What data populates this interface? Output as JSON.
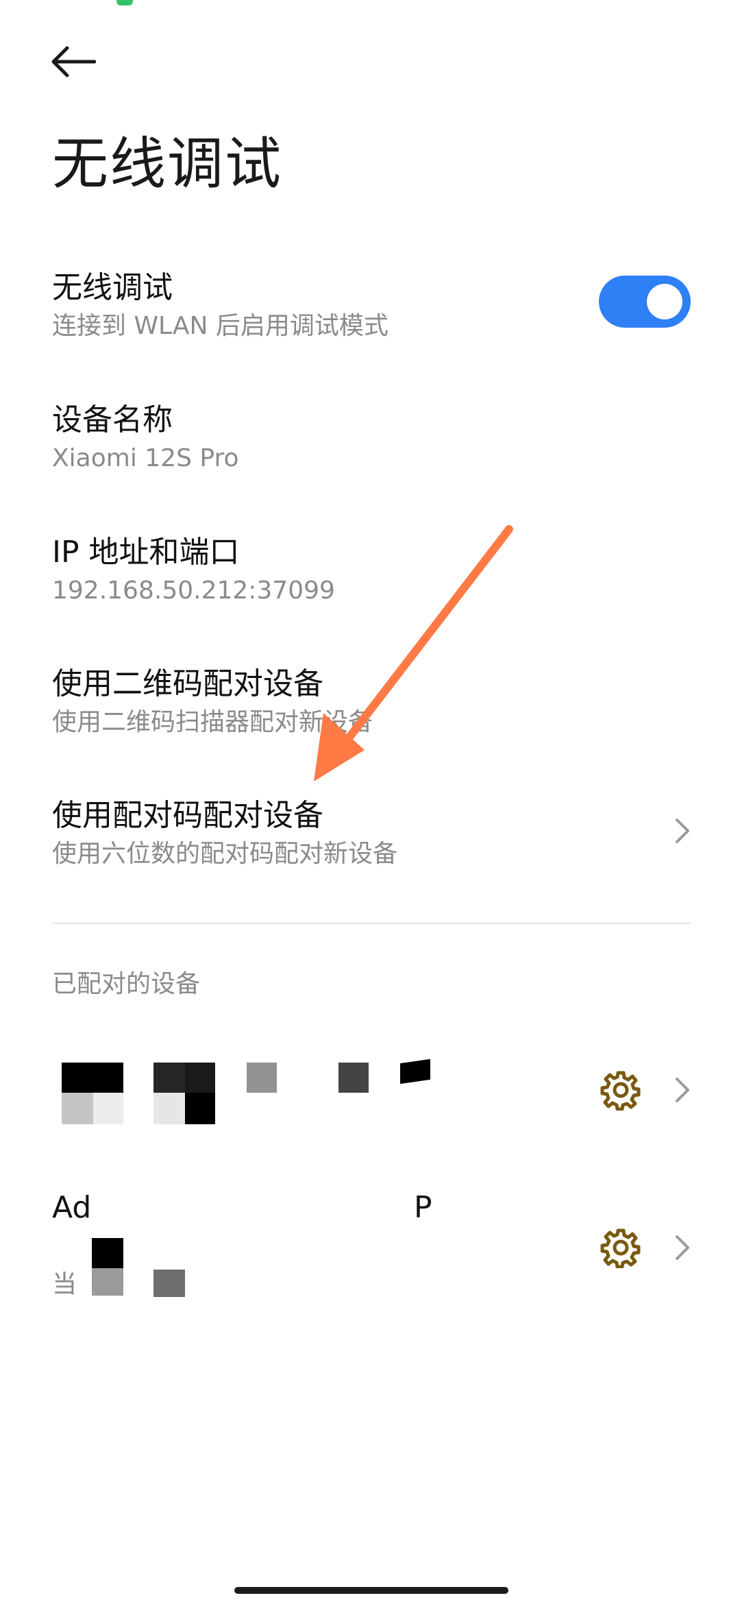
{
  "page": {
    "title": "无线调试"
  },
  "settings": {
    "wireless_debugging": {
      "title": "无线调试",
      "subtitle": "连接到 WLAN 后启用调试模式",
      "enabled": true
    },
    "device_name": {
      "title": "设备名称",
      "value": "Xiaomi 12S Pro"
    },
    "ip_port": {
      "title": "IP 地址和端口",
      "value": "192.168.50.212:37099"
    },
    "pair_qr": {
      "title": "使用二维码配对设备",
      "subtitle": "使用二维码扫描器配对新设备"
    },
    "pair_code": {
      "title": "使用配对码配对设备",
      "subtitle": "使用六位数的配对码配对新设备"
    }
  },
  "paired_devices": {
    "header": "已配对的设备",
    "devices": [
      {
        "name": ""
      },
      {
        "name": "Ad",
        "name_end": "P",
        "status": "当"
      }
    ]
  },
  "colors": {
    "toggle_on": "#2f7ff5",
    "gear": "#7a5a0f",
    "annotation_arrow": "#ff7a45"
  },
  "icons": {
    "back": "arrow-left-icon",
    "chevron": "chevron-right-icon",
    "gear": "gear-icon"
  }
}
